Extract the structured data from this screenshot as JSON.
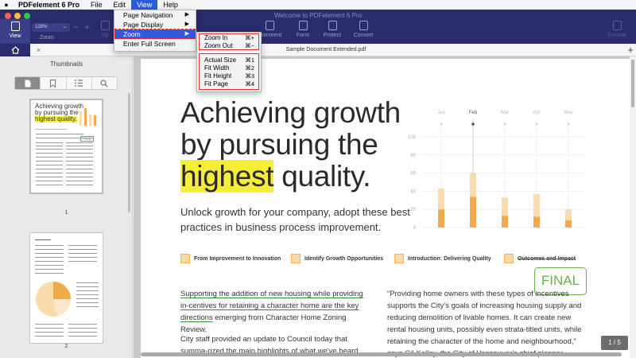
{
  "menubar": {
    "app": "PDFelement 6 Pro",
    "items": [
      "File",
      "Edit",
      "View",
      "Help"
    ]
  },
  "window": {
    "title": "Welcome to PDFelement 6 Pro"
  },
  "toolbar": {
    "view": "View",
    "zoom_value": "128%",
    "zoom_label": "Zoom",
    "buttons": [
      "Comment",
      "Form",
      "Protect",
      "Convert",
      "Format"
    ],
    "up_label": "Up"
  },
  "tabs": {
    "document": "Sample Document Extended.pdf"
  },
  "sidebar": {
    "title": "Thumbnails",
    "thumb1_label": "1",
    "thumb2_label": "2",
    "thumb1_head": [
      "Achieving growth",
      "by pursuing the",
      "highest quality."
    ],
    "thumb1_final": "FINAL"
  },
  "view_menu": {
    "items": [
      {
        "label": "Page Navigation",
        "arrow": "▶"
      },
      {
        "label": "Page Display",
        "arrow": "▶"
      },
      {
        "label": "Zoom",
        "arrow": "▶"
      },
      {
        "label": "Enter Full Screen",
        "arrow": ""
      }
    ]
  },
  "zoom_menu": {
    "group1": [
      {
        "label": "Zoom In",
        "shortcut": "⌘+"
      },
      {
        "label": "Zoom Out",
        "shortcut": "⌘−"
      }
    ],
    "group2": [
      {
        "label": "Actual Size",
        "shortcut": "⌘1"
      },
      {
        "label": "Fit Width",
        "shortcut": "⌘2"
      },
      {
        "label": "Fit Height",
        "shortcut": "⌘3"
      },
      {
        "label": "Fit Page",
        "shortcut": "⌘4"
      }
    ]
  },
  "document": {
    "headline_1": "Achieving growth",
    "headline_2": "by pursuing the",
    "headline_3a": "highest",
    "headline_3b": " quality.",
    "subline": "Unlock growth for your company, adopt these best practices in business process improvement.",
    "features": [
      "From Improvement to Innovation",
      "Identify Growth Opportunities",
      "Introduction: Delivering Quality",
      "Outcomes and Impact"
    ],
    "stamp": "FINAL",
    "col_left_underlined": "Supporting the addition of new housing while providing in-centives for retaining a character home are the key directions",
    "col_left_rest": " emerging from Character Home Zoning Review.",
    "col_left_p2": "City staff provided an update to Council today that summa-rized the main highlights of what we've heard through recent",
    "col_right": "“Providing home owners with these types of incentives supports the City’s goals of increasing housing supply and reducing demolition of livable homes.  It can create new rental housing units, possibly even strata-titled units, while retaining the character of the home and neighbourhood,” says Gil Kelley, the City of Vancouver’s chief planner.",
    "page_indicator": "1 / 5"
  },
  "chart_data": {
    "type": "bar",
    "categories": [
      "Jan",
      "Feb",
      "Mar",
      "Apr",
      "May"
    ],
    "highlighted_category": "Feb",
    "y_ticks": [
      0,
      20,
      40,
      60,
      80,
      100
    ],
    "ylim": [
      0,
      100
    ],
    "series": [
      {
        "values": [
          20,
          34,
          13,
          12,
          8
        ]
      },
      {
        "values": [
          23,
          26,
          20,
          25,
          12
        ]
      }
    ],
    "colors": {
      "lower": "#f2a949",
      "upper": "#f9dcae"
    }
  }
}
